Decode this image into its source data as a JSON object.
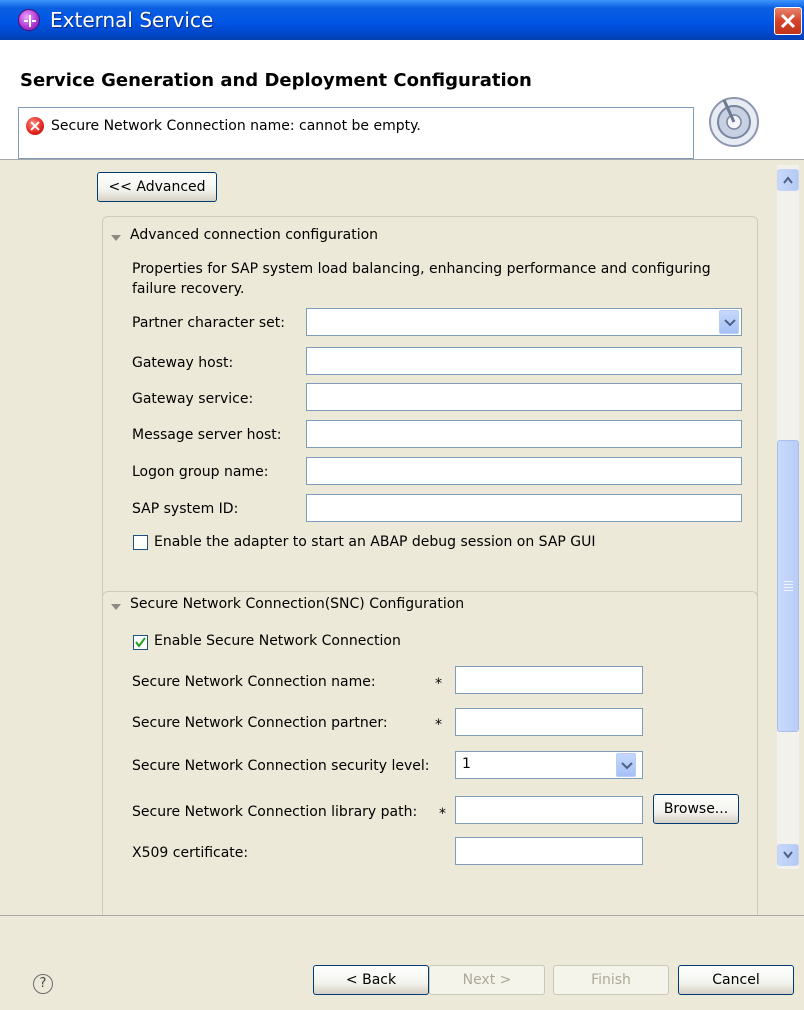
{
  "window": {
    "title": "External Service",
    "title_bar_color": "#0055e5"
  },
  "header": {
    "title": "Service Generation and Deployment Configuration",
    "error_message": "Secure Network Connection name: cannot be empty."
  },
  "advanced_button": {
    "label": "<< Advanced"
  },
  "advanced_section": {
    "title": "Advanced connection configuration",
    "description_line1": "Properties for SAP system load balancing, enhancing performance and configuring",
    "description_line2": "failure recovery.",
    "partner_charset": {
      "label": "Partner character set:",
      "value": ""
    },
    "gateway_host": {
      "label": "Gateway host:",
      "value": ""
    },
    "gateway_service": {
      "label": "Gateway service:",
      "value": ""
    },
    "message_server_host": {
      "label": "Message server host:",
      "value": ""
    },
    "logon_group_name": {
      "label": "Logon group name:",
      "value": ""
    },
    "sap_system_id": {
      "label": "SAP system ID:",
      "value": ""
    },
    "abap_debug": {
      "label": "Enable the adapter to start an ABAP debug session on SAP GUI",
      "checked": false
    }
  },
  "snc_section": {
    "title": "Secure Network Connection(SNC) Configuration",
    "enable_snc": {
      "label": "Enable Secure Network Connection",
      "checked": true
    },
    "snc_name": {
      "label": "Secure Network Connection name:",
      "required_mark": "*",
      "value": ""
    },
    "snc_partner": {
      "label": "Secure Network Connection partner:",
      "required_mark": "*",
      "value": ""
    },
    "snc_security_level": {
      "label": "Secure Network Connection security level:",
      "value": "1"
    },
    "snc_library_path": {
      "label": "Secure Network Connection library path:",
      "required_mark": "*",
      "value": ""
    },
    "browse_button": "Browse...",
    "x509": {
      "label": "X509 certificate:",
      "value": ""
    }
  },
  "footer": {
    "help_icon": "?",
    "back_label": "< Back",
    "next_label": "Next >",
    "finish_label": "Finish",
    "cancel_label": "Cancel"
  }
}
